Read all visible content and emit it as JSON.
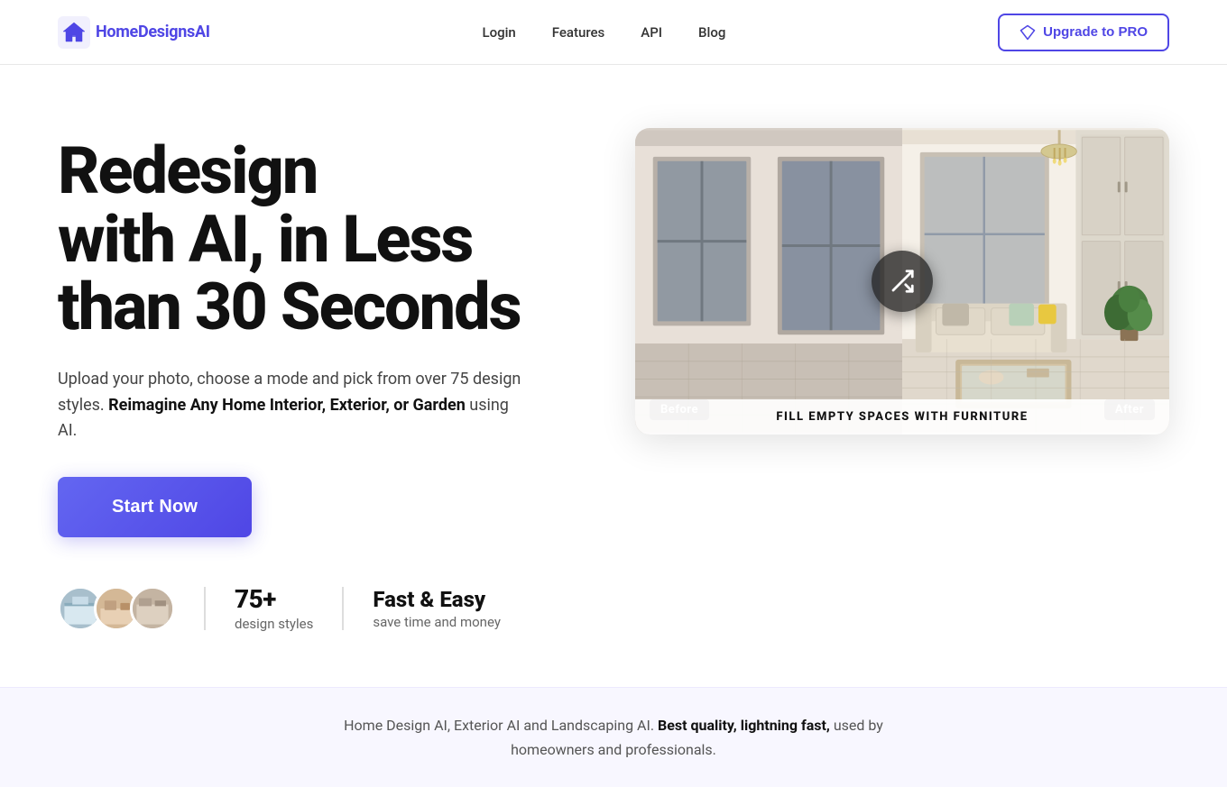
{
  "nav": {
    "logo_text_home": "Home",
    "logo_text_designs": "Designs",
    "logo_text_ai": "AI",
    "links": [
      {
        "label": "Login",
        "href": "#"
      },
      {
        "label": "Features",
        "href": "#"
      },
      {
        "label": "API",
        "href": "#"
      },
      {
        "label": "Blog",
        "href": "#"
      }
    ],
    "upgrade_label": "Upgrade to PRO"
  },
  "hero": {
    "heading_line1": "Redesign",
    "heading_line2": "with AI, in Less",
    "heading_line3": "than 30 Seconds",
    "subtext_plain": "Upload your photo, choose a mode and pick from over 75 design styles. ",
    "subtext_bold": "Reimagine Any Home Interior, Exterior, or Garden",
    "subtext_end": " using AI.",
    "cta_label": "Start Now"
  },
  "stats": {
    "number": "75+",
    "label": "design styles",
    "title": "Fast & Easy",
    "subtitle": "save time and money"
  },
  "before_after": {
    "before_label": "Before",
    "after_label": "After",
    "fill_label_bold": "FILL EMPTY SPACES",
    "fill_label_rest": " WITH FURNITURE"
  },
  "bottom": {
    "text_plain": "Home Design AI, Exterior AI and Landscaping AI. ",
    "text_bold": "Best quality, lightning fast,",
    "text_end": " used by homeowners and professionals."
  },
  "icons": {
    "logo_icon": "house-icon",
    "upgrade_icon": "diamond-icon",
    "shuffle_icon": "shuffle-icon"
  },
  "colors": {
    "accent": "#4f46e5",
    "accent_light": "#6366f1",
    "text_dark": "#111111",
    "text_mid": "#444444",
    "text_light": "#666666",
    "bg_light": "#f8f7ff"
  }
}
